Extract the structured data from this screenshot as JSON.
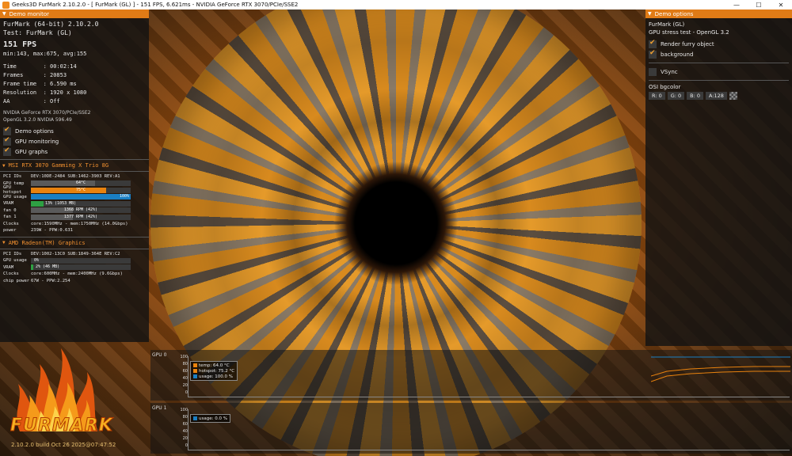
{
  "window": {
    "title": "Geeks3D FurMark 2.10.2.0 - [ FurMark (GL) ] - 151 FPS, 6.621ms - NVIDIA GeForce RTX 3070/PCIe/SSE2",
    "minimize": "—",
    "maximize": "☐",
    "close": "✕"
  },
  "demo_monitor": {
    "header": "Demo monitor",
    "app": "FurMark (64-bit) 2.10.2.0",
    "test": "Test: FurMark (GL)",
    "fps": "151 FPS",
    "fps_stats": "min:143, max:675, avg:155",
    "time": "Time        : 00:02:14",
    "frames": "Frames      : 20853",
    "frame_time": "Frame time  : 6.590 ms",
    "resolution": "Resolution  : 1920 x 1080",
    "aa": "AA          : Off",
    "gpu_name": "NVIDIA GeForce RTX 3070/PCIe/SSE2",
    "opengl": "OpenGL 3.2.0 NVIDIA 596.49",
    "options": [
      {
        "label": "Demo options",
        "checked": true
      },
      {
        "label": "GPU monitoring",
        "checked": true
      },
      {
        "label": "GPU graphs",
        "checked": true
      }
    ]
  },
  "gpu0": {
    "name": "MSI RTX 3070 Gamming X Trio 8G",
    "pci": {
      "label": "PCI IDs",
      "value": "DEV:10DE-2484 SUB:1462-3903 REV:A1"
    },
    "temp": {
      "label": "GPU temp",
      "text": "64°C",
      "percent": 64,
      "color": "#5a5a5a"
    },
    "hotspot": {
      "label": "GPU hotspot",
      "text": "75°C",
      "percent": 75,
      "color": "#e8820e"
    },
    "usage": {
      "label": "GPU usage",
      "text": "100%",
      "percent": 100,
      "color": "#1a7fc4"
    },
    "vram": {
      "label": "VRAM",
      "text": "13% (1053 MB)",
      "percent": 13,
      "color": "#2ea043"
    },
    "fan0": {
      "label": "fan 0",
      "text": "1368 RPM (42%)",
      "percent": 42,
      "color": "#5a5a5a"
    },
    "fan1": {
      "label": "fan 1",
      "text": "1377 RPM (42%)",
      "percent": 42,
      "color": "#5a5a5a"
    },
    "clocks": {
      "label": "Clocks",
      "value": "core:1590MHz - mem:1750MHz (14.0Gbps)"
    },
    "power": {
      "label": "power",
      "value": "239W - PPW:0.631"
    }
  },
  "gpu1": {
    "name": "AMD Radeon(TM) Graphics",
    "pci": {
      "label": "PCI IDs",
      "value": "DEV:1002-13C0 SUB:1849-364E REV:C2"
    },
    "usage": {
      "label": "GPU usage",
      "text": "0%",
      "percent": 0,
      "color": "#1a7fc4"
    },
    "vram": {
      "label": "VRAM",
      "text": "2% (46 MB)",
      "percent": 2,
      "color": "#2ea043"
    },
    "clocks": {
      "label": "Clocks",
      "value": "core:600MHz - mem:2400MHz (9.6Gbps)"
    },
    "chip_power": {
      "label": "chip power",
      "value": "67W - PPW:2.254"
    }
  },
  "demo_options": {
    "header": "Demo options",
    "title": "FurMark (GL)",
    "subtitle": "GPU stress test - OpenGL 3.2",
    "render_furry": {
      "label": "Render furry object",
      "checked": true
    },
    "background": {
      "label": "background",
      "checked": true
    },
    "vsync": {
      "label": "VSync",
      "checked": false
    },
    "osi_label": "OSI bgcolor",
    "r": "R: 0",
    "g": "G: 0",
    "b": "B: 0",
    "a": "A:128"
  },
  "graphs": {
    "g0": {
      "label": "GPU 0",
      "ticks": [
        "100",
        "80",
        "60",
        "40",
        "20",
        "0"
      ],
      "legend": [
        {
          "text": "temp: 64.0 °C",
          "color": "#e8820e"
        },
        {
          "text": "hotspot: 75.2 °C",
          "color": "#e8820e"
        },
        {
          "text": "usage: 100.0 %",
          "color": "#1a7fc4"
        }
      ]
    },
    "g1": {
      "label": "GPU 1",
      "ticks": [
        "100",
        "80",
        "60",
        "40",
        "20",
        "0"
      ],
      "legend": [
        {
          "text": "usage: 0.0 %",
          "color": "#1a7fc4"
        }
      ]
    }
  },
  "logo": {
    "text": "FURMARK",
    "build": "2.10.2.0 build Oct 26 2025@07:47:52"
  }
}
